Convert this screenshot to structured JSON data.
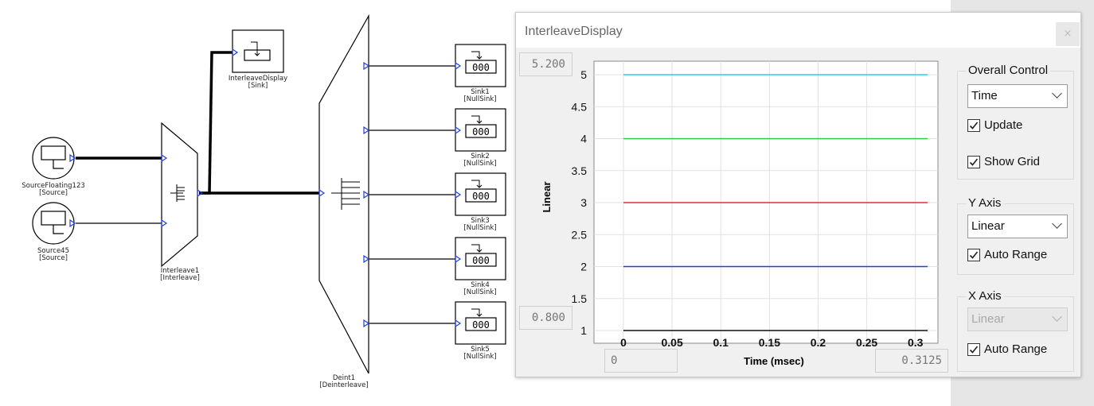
{
  "diagram": {
    "blocks": [
      {
        "id": "src1",
        "name": "SourceFloating123",
        "type": "[Source]"
      },
      {
        "id": "src2",
        "name": "Source45",
        "type": "[Source]"
      },
      {
        "id": "interleave",
        "name": "Interleave1",
        "type": "[Interleave]"
      },
      {
        "id": "display",
        "name": "InterleaveDisplay",
        "type": "[Sink]"
      },
      {
        "id": "deint",
        "name": "Deint1",
        "type": "[Deinterleave]"
      },
      {
        "id": "sink1",
        "name": "Sink1",
        "type": "[NullSink]"
      },
      {
        "id": "sink2",
        "name": "Sink2",
        "type": "[NullSink]"
      },
      {
        "id": "sink3",
        "name": "Sink3",
        "type": "[NullSink]"
      },
      {
        "id": "sink4",
        "name": "Sink4",
        "type": "[NullSink]"
      },
      {
        "id": "sink5",
        "name": "Sink5",
        "type": "[NullSink]"
      }
    ],
    "sink_counter_text": "000"
  },
  "window": {
    "title": "InterleaveDisplay",
    "close_label": "×",
    "y_max_value": "5.200",
    "y_min_value": "0.800",
    "x_min_value": "0",
    "x_max_value": "0.3125"
  },
  "controls": {
    "overall": {
      "title": "Overall Control",
      "select_value": "Time",
      "update": {
        "label": "Update",
        "checked": true
      },
      "show_grid": {
        "label": "Show Grid",
        "checked": true
      }
    },
    "y_axis": {
      "title": "Y Axis",
      "select_value": "Linear",
      "auto_range": {
        "label": "Auto Range",
        "checked": true
      }
    },
    "x_axis": {
      "title": "X Axis",
      "select_value": "Linear",
      "select_disabled": true,
      "auto_range": {
        "label": "Auto Range",
        "checked": true
      }
    }
  },
  "chart_data": {
    "type": "line",
    "xlabel": "Time (msec)",
    "ylabel": "Linear",
    "xlim": [
      0,
      0.3125
    ],
    "ylim": [
      0.8,
      5.2
    ],
    "x_ticks": [
      "0",
      "0.05",
      "0.1",
      "0.15",
      "0.2",
      "0.25",
      "0.3"
    ],
    "y_ticks": [
      "1",
      "1.5",
      "2",
      "2.5",
      "3",
      "3.5",
      "4",
      "4.5",
      "5"
    ],
    "grid": true,
    "series": [
      {
        "x": [
          0,
          0.3125
        ],
        "y": [
          5,
          5
        ],
        "color": "#22d3e0"
      },
      {
        "x": [
          0,
          0.3125
        ],
        "y": [
          4,
          4
        ],
        "color": "#2ecc40"
      },
      {
        "x": [
          0,
          0.3125
        ],
        "y": [
          3,
          3
        ],
        "color": "#e0302e"
      },
      {
        "x": [
          0,
          0.3125
        ],
        "y": [
          2,
          2
        ],
        "color": "#1f3fd8"
      },
      {
        "x": [
          0,
          0.3125
        ],
        "y": [
          1,
          1
        ],
        "color": "#111111"
      }
    ]
  }
}
